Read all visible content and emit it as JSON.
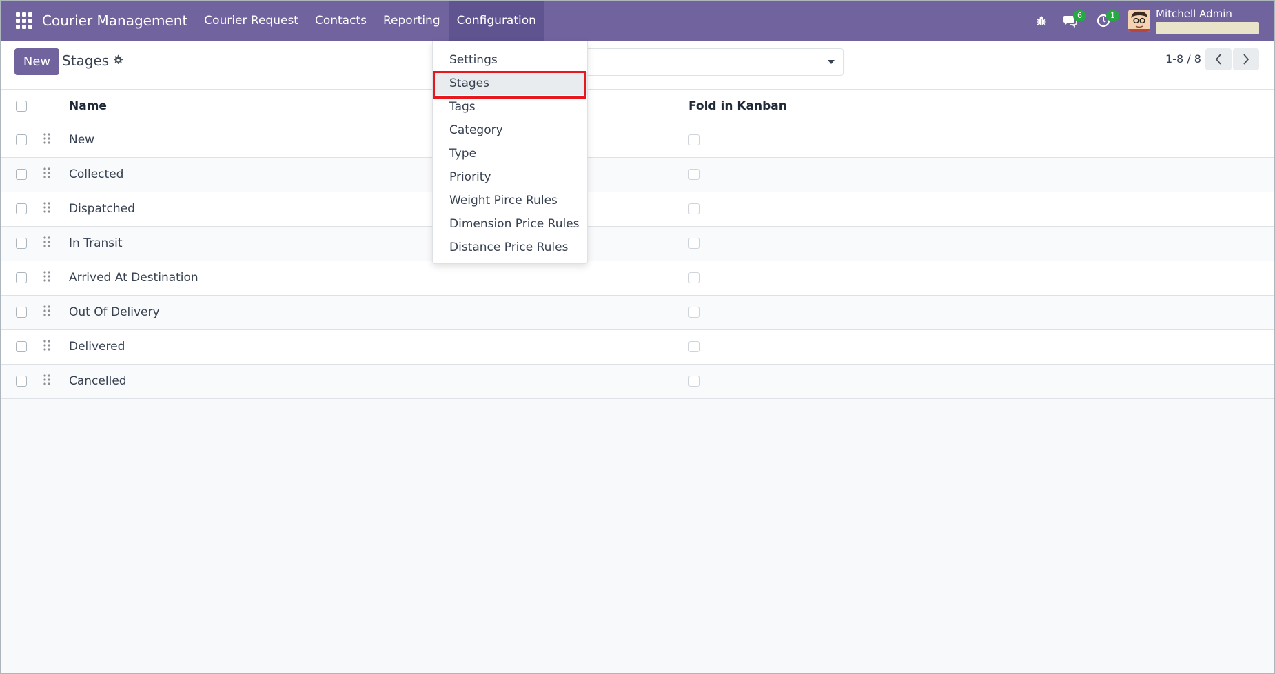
{
  "navbar": {
    "brand": "Courier Management",
    "menu": [
      {
        "label": "Courier Request"
      },
      {
        "label": "Contacts"
      },
      {
        "label": "Reporting"
      },
      {
        "label": "Configuration"
      }
    ],
    "messages_count": "6",
    "activities_count": "1",
    "user_name": "Mitchell Admin",
    "icons": [
      "apps-grid-icon",
      "bug-icon",
      "chat-icon",
      "clock-icon"
    ]
  },
  "control_panel": {
    "new_label": "New",
    "title": "Stages",
    "pager": "1-8 / 8"
  },
  "table": {
    "columns": [
      "Name",
      "Fold in Kanban"
    ],
    "rows": [
      {
        "name": "New"
      },
      {
        "name": "Collected"
      },
      {
        "name": "Dispatched"
      },
      {
        "name": "In Transit"
      },
      {
        "name": "Arrived At Destination"
      },
      {
        "name": "Out Of Delivery"
      },
      {
        "name": "Delivered"
      },
      {
        "name": "Cancelled"
      }
    ]
  },
  "config_menu": {
    "items": [
      {
        "label": "Settings"
      },
      {
        "label": "Stages"
      },
      {
        "label": "Tags"
      },
      {
        "label": "Category"
      },
      {
        "label": "Type"
      },
      {
        "label": "Priority"
      },
      {
        "label": "Weight Pirce Rules"
      },
      {
        "label": "Dimension Price Rules"
      },
      {
        "label": "Distance Price Rules"
      }
    ],
    "selected": "Stages"
  },
  "colors": {
    "navbar": "#71639e",
    "highlight": "#e8161d",
    "badge": "#28a745"
  }
}
